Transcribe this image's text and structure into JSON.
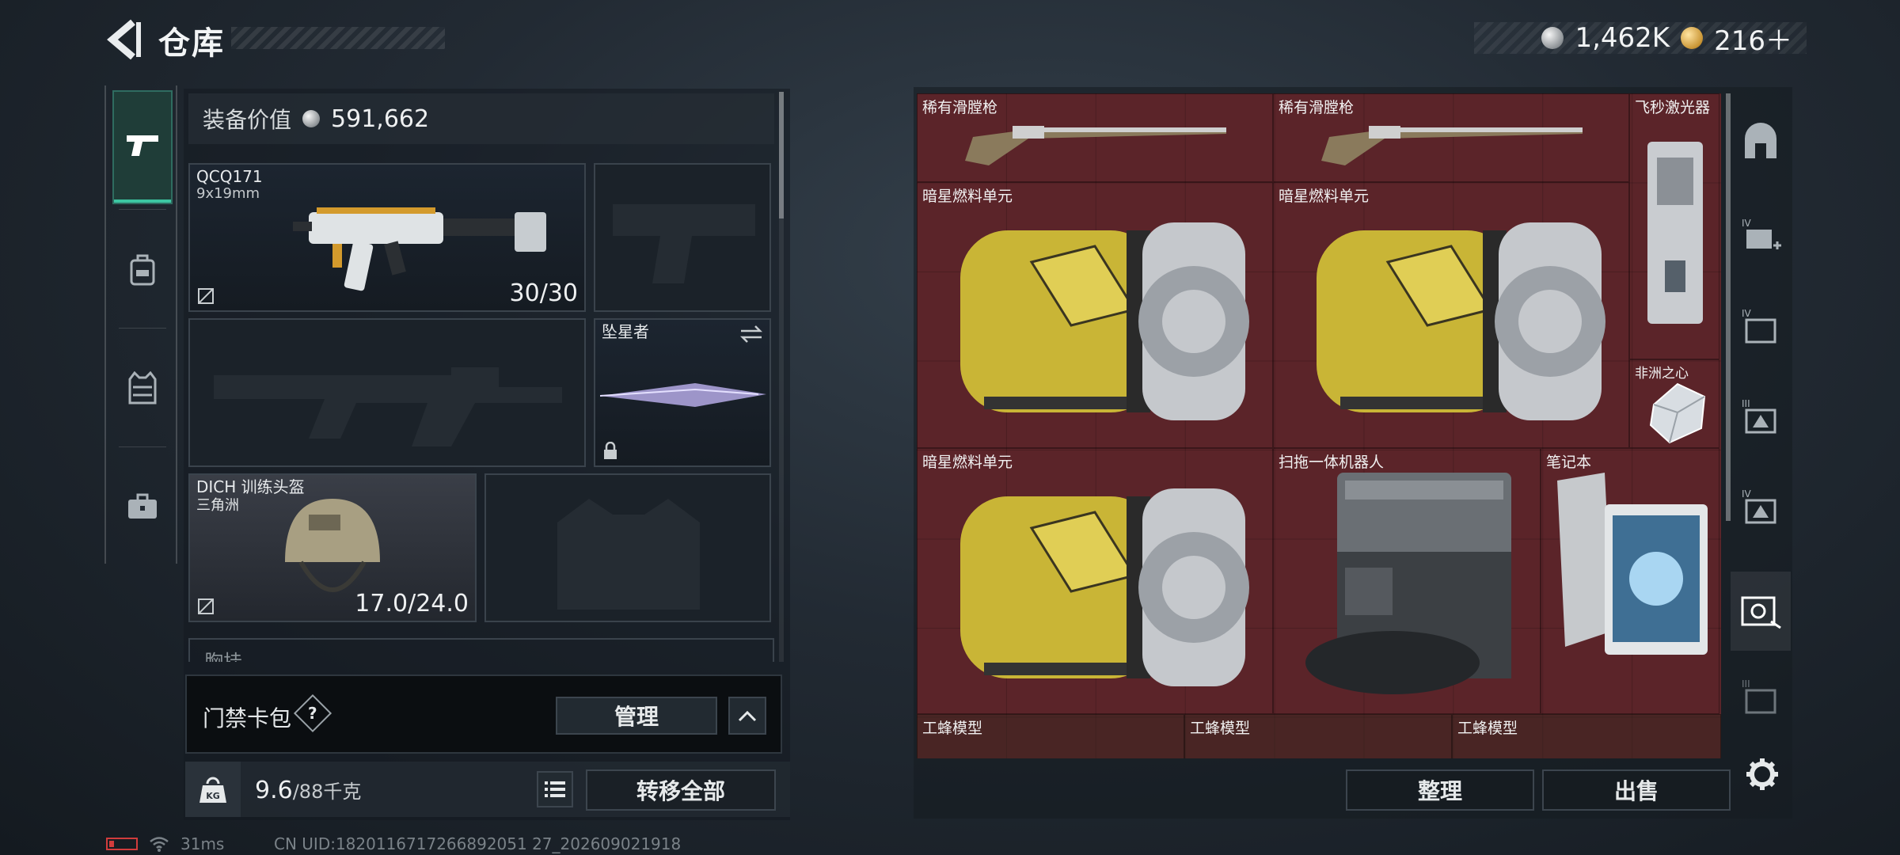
{
  "header": {
    "title": "仓库",
    "currency": [
      {
        "icon": "silver-coin-icon",
        "value": "1,462K"
      },
      {
        "icon": "gold-coin-icon",
        "value": "216＋"
      }
    ]
  },
  "left_nav": {
    "items": [
      {
        "name": "weapon-tab",
        "icon": "pistol-icon",
        "active": true
      },
      {
        "name": "backpack-tab",
        "icon": "backpack-icon",
        "active": false
      },
      {
        "name": "vest-tab",
        "icon": "vest-icon",
        "active": false
      },
      {
        "name": "toolbox-tab",
        "icon": "briefcase-icon",
        "active": false
      }
    ]
  },
  "loadout": {
    "equip_value_label": "装备价值",
    "equip_value": "591,662",
    "primary_weapon": {
      "name": "QCQ171",
      "ammo_type": "9x19mm",
      "ammo": "30/30"
    },
    "melee": {
      "name": "坠星者"
    },
    "helmet": {
      "name": "DICH 训练头盔",
      "sub": "三角洲",
      "durability": "17.0/24.0"
    },
    "chest_rig_label": "胸挂"
  },
  "keycard": {
    "label": "门禁卡包",
    "help": "?",
    "manage_label": "管理"
  },
  "weight": {
    "current": "9.6",
    "max": "/88千克",
    "kg_label": "KG"
  },
  "transfer_all_label": "转移全部",
  "status": {
    "ping": "31ms",
    "uid": "CN UID:1820116717266892051 27_202609021918"
  },
  "stash": {
    "items": [
      {
        "name": "稀有滑膛枪"
      },
      {
        "name": "稀有滑膛枪"
      },
      {
        "name": "飞秒激光器"
      },
      {
        "name": "暗星燃料单元"
      },
      {
        "name": "暗星燃料单元"
      },
      {
        "name": "非洲之心"
      },
      {
        "name": "暗星燃料单元"
      },
      {
        "name": "扫拖一体机器人"
      },
      {
        "name": "笔记本"
      },
      {
        "name": "工蜂模型"
      },
      {
        "name": "工蜂模型"
      },
      {
        "name": "工蜂模型"
      }
    ],
    "sort_label": "整理",
    "sell_label": "出售"
  },
  "right_nav": {
    "items": [
      {
        "icon": "arch-icon"
      },
      {
        "icon": "stash-add-icon",
        "tier": "IV"
      },
      {
        "icon": "stash-iv-icon",
        "tier": "IV"
      },
      {
        "icon": "stash-iii-icon",
        "tier": "III"
      },
      {
        "icon": "stash-iv-b-icon",
        "tier": "IV"
      },
      {
        "icon": "stash-active-icon",
        "tier": ""
      },
      {
        "icon": "stash-iii-b-icon",
        "tier": "III"
      }
    ]
  },
  "colors": {
    "accent": "#3cc6a2",
    "stash_bg": "#5b2429",
    "fuel_yellow": "#c9b536"
  }
}
